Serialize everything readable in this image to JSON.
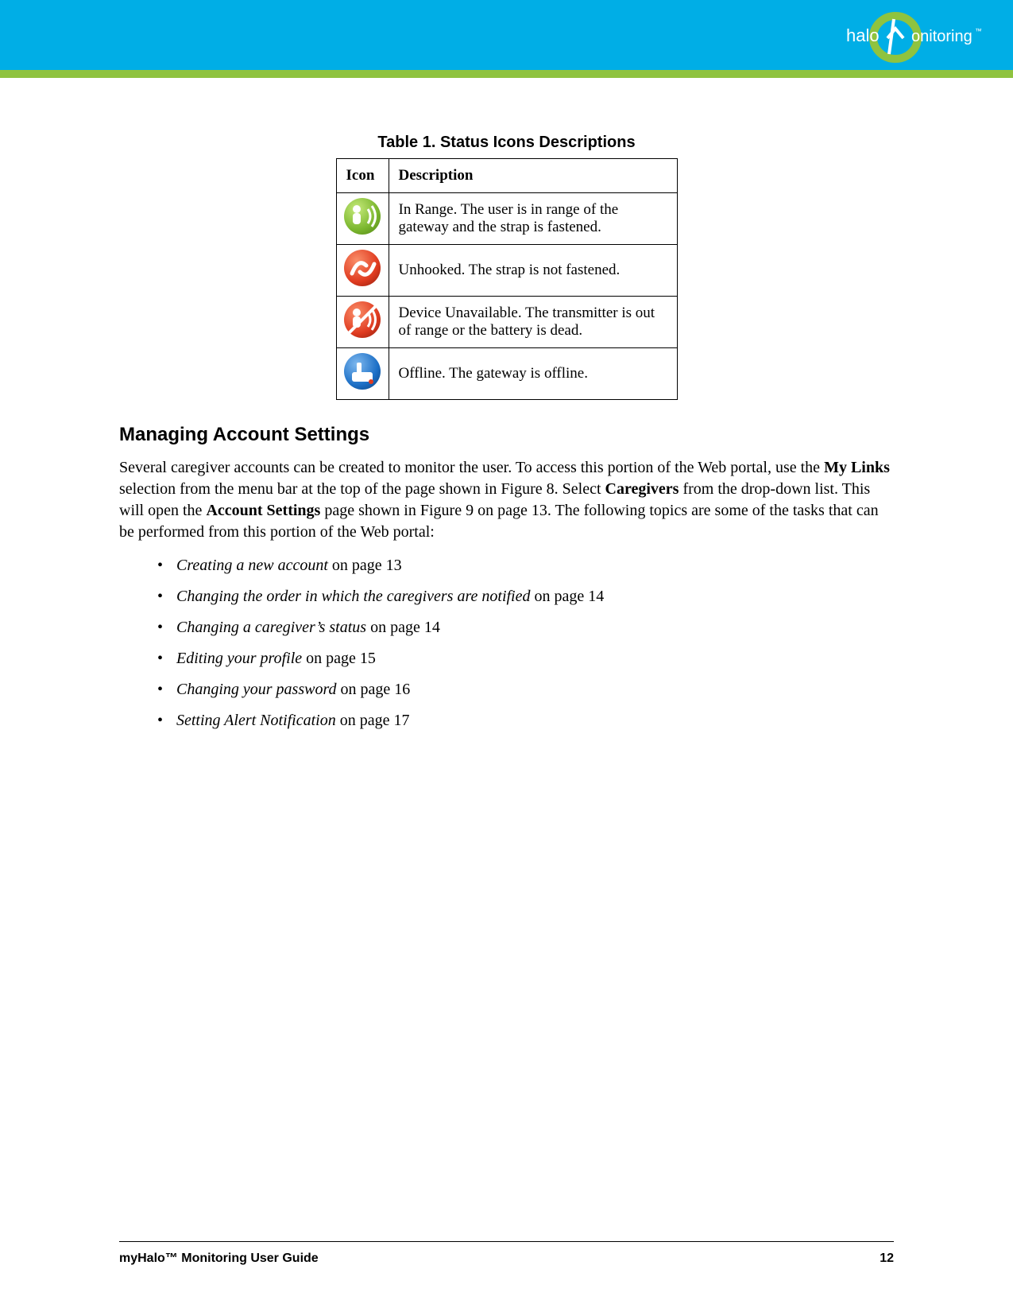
{
  "brand": {
    "name_part1": "halo",
    "name_part2": "onitoring",
    "tm": "™"
  },
  "table": {
    "caption": "Table 1. Status Icons Descriptions",
    "headers": {
      "icon": "Icon",
      "desc": "Description"
    },
    "rows": [
      {
        "icon_name": "in-range-icon",
        "desc": "In Range. The user is in range of the gateway and the strap is fastened."
      },
      {
        "icon_name": "unhooked-icon",
        "desc": "Unhooked. The strap is not fastened."
      },
      {
        "icon_name": "device-unavailable-icon",
        "desc": "Device Unavailable. The transmitter is out of range or the battery is dead."
      },
      {
        "icon_name": "offline-icon",
        "desc": "Offline. The gateway is offline."
      }
    ]
  },
  "section_heading": "Managing Account Settings",
  "paragraph_parts": {
    "p1": "Several caregiver accounts can be created to monitor the user. To access this portion of the Web portal, use the ",
    "p2": "My Links",
    "p3": " selection from the menu bar at the top of the page shown in Figure 8. Select ",
    "p4": "Caregivers",
    "p5": " from the drop-down list. This will open the ",
    "p6": "Account Settings",
    "p7": " page shown in Figure 9 on page 13. The following topics are some of the tasks that can be performed from this portion of the Web portal:"
  },
  "tasks": [
    {
      "title": "Creating a new account",
      "suffix": " on page 13"
    },
    {
      "title": "Changing the order in which the caregivers are notified",
      "suffix": " on page 14"
    },
    {
      "title": "Changing a caregiver’s status",
      "suffix": " on page 14"
    },
    {
      "title": "Editing your profile",
      "suffix": " on page 15"
    },
    {
      "title": "Changing your password",
      "suffix": " on page 16"
    },
    {
      "title": "Setting Alert Notification",
      "suffix": " on page 17"
    }
  ],
  "footer": {
    "left": "myHalo™ Monitoring User Guide",
    "right": "12"
  }
}
